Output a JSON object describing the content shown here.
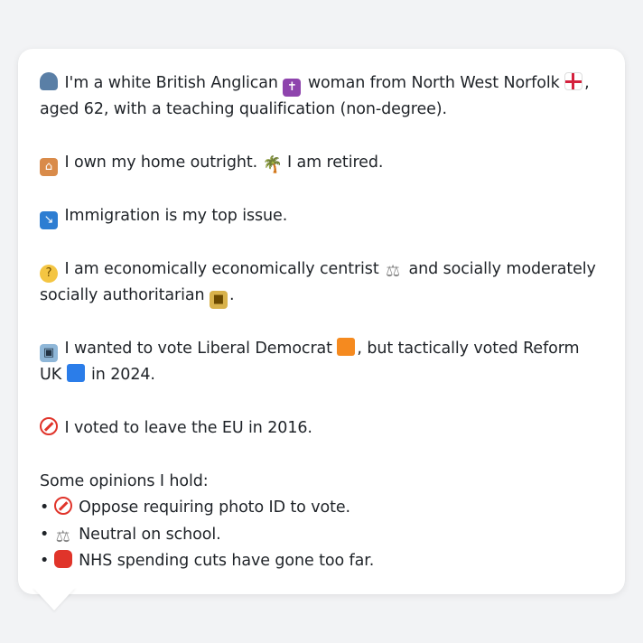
{
  "profile": {
    "identity": {
      "icon": "person-silhouette-icon",
      "text1": "I'm a white British Anglican",
      "icon2": "latin-cross-icon",
      "text2": "woman from North West Norfolk",
      "icon3": "england-flag-icon",
      "text3": ", aged",
      "text4": "62, with a teaching qualification (non-degree)."
    },
    "home": {
      "icon": "house-icon",
      "text1": "I own my home outright.",
      "icon2": "palm-tree-icon",
      "text2": "I am retired."
    },
    "issue": {
      "icon": "passport-control-icon",
      "text": "Immigration is my top issue."
    },
    "politics": {
      "icon": "thinking-face-icon",
      "text1": "I am economically economically centrist",
      "icon2": "balance-scale-icon",
      "text2": "and socially moderately",
      "text3": "socially authoritarian",
      "icon3": "lock-icon",
      "text4": "."
    },
    "vote": {
      "icon": "ballot-box-icon",
      "text1": "I wanted to vote Liberal Democrat",
      "icon2": "orange-square-icon",
      "text2": ", but tactically voted Reform UK",
      "icon3": "blue-square-icon",
      "text3": "in 2024."
    },
    "eu": {
      "icon": "prohibited-icon",
      "text": "I voted to leave the EU in 2016."
    },
    "opinions": {
      "heading": "Some opinions I hold:",
      "items": [
        {
          "bullet": "•",
          "icon": "prohibited-icon",
          "text": "Oppose requiring photo ID to vote."
        },
        {
          "bullet": "•",
          "icon": "balance-scale-icon",
          "text": "Neutral on school."
        },
        {
          "bullet": "•",
          "icon": "stop-sign-icon",
          "text": "NHS spending cuts have gone too far."
        }
      ]
    }
  },
  "colors": {
    "background": "#f2f3f5",
    "bubble": "#ffffff",
    "text": "#1f2328"
  }
}
